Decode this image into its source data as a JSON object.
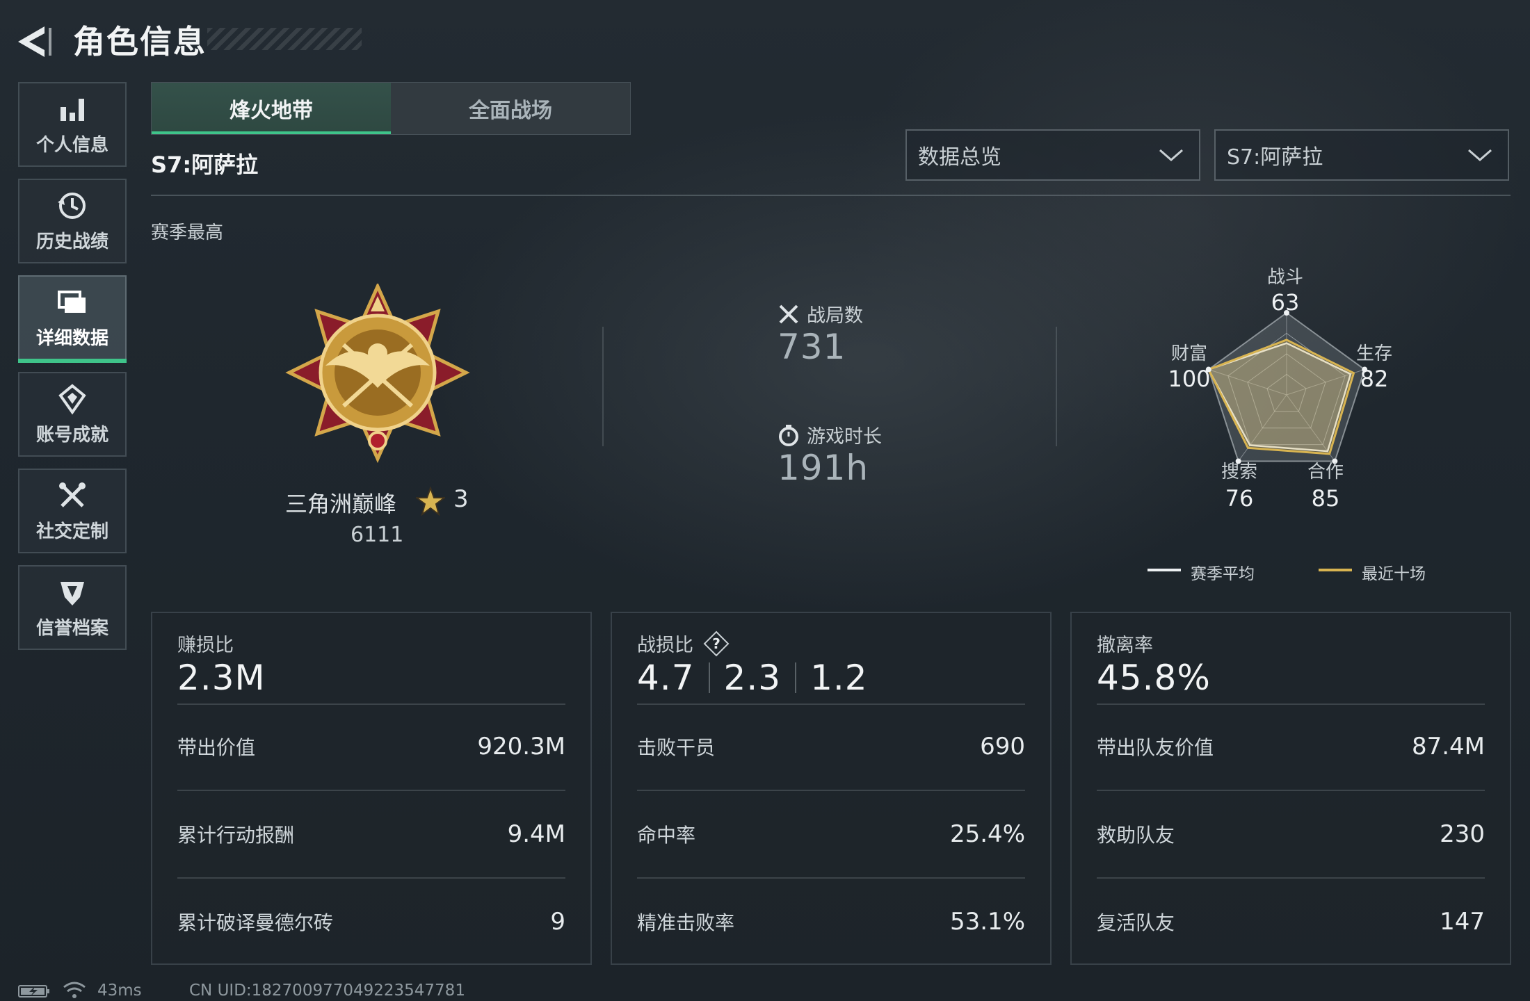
{
  "header": {
    "title": "角色信息"
  },
  "sidebar": {
    "items": [
      {
        "label": "个人信息",
        "icon": "bar-chart-icon"
      },
      {
        "label": "历史战绩",
        "icon": "history-icon"
      },
      {
        "label": "详细数据",
        "icon": "stacked-cards-icon",
        "active": true
      },
      {
        "label": "账号成就",
        "icon": "achievement-icon"
      },
      {
        "label": "社交定制",
        "icon": "tools-icon"
      },
      {
        "label": "信誉档案",
        "icon": "shield-icon"
      }
    ]
  },
  "tabs": [
    {
      "label": "烽火地带",
      "active": true
    },
    {
      "label": "全面战场",
      "active": false
    }
  ],
  "season_title": "S7:阿萨拉",
  "filters": {
    "overview": "数据总览",
    "season": "S7:阿萨拉"
  },
  "season_best_label": "赛季最高",
  "rank": {
    "name": "三角洲巅峰",
    "stars": "3",
    "score": "6111"
  },
  "summary": {
    "matches_label": "战局数",
    "matches": "731",
    "playtime_label": "游戏时长",
    "playtime": "191h"
  },
  "radar": {
    "labels": {
      "combat": "战斗",
      "survival": "生存",
      "cooperation": "合作",
      "search": "搜索",
      "wealth": "财富"
    },
    "values": {
      "combat": "63",
      "survival": "82",
      "cooperation": "85",
      "search": "76",
      "wealth": "100"
    },
    "legend": {
      "season_avg": "赛季平均",
      "recent_ten": "最近十场"
    },
    "colors": {
      "season_avg": "#eef1f3",
      "recent_ten": "#d8b451"
    }
  },
  "panels": {
    "profit": {
      "title": "赚损比",
      "value": "2.3M",
      "rows": [
        {
          "label": "带出价值",
          "value": "920.3M"
        },
        {
          "label": "累计行动报酬",
          "value": "9.4M"
        },
        {
          "label": "累计破译曼德尔砖",
          "value": "9"
        }
      ]
    },
    "kd": {
      "title": "战损比",
      "values": [
        "4.7",
        "2.3",
        "1.2"
      ],
      "rows": [
        {
          "label": "击败干员",
          "value": "690"
        },
        {
          "label": "命中率",
          "value": "25.4%"
        },
        {
          "label": "精准击败率",
          "value": "53.1%"
        }
      ]
    },
    "extract": {
      "title": "撤离率",
      "value": "45.8%",
      "rows": [
        {
          "label": "带出队友价值",
          "value": "87.4M"
        },
        {
          "label": "救助队友",
          "value": "230"
        },
        {
          "label": "复活队友",
          "value": "147"
        }
      ]
    }
  },
  "status": {
    "ping": "43ms",
    "uid": "CN UID:18270097704922354778​1"
  }
}
